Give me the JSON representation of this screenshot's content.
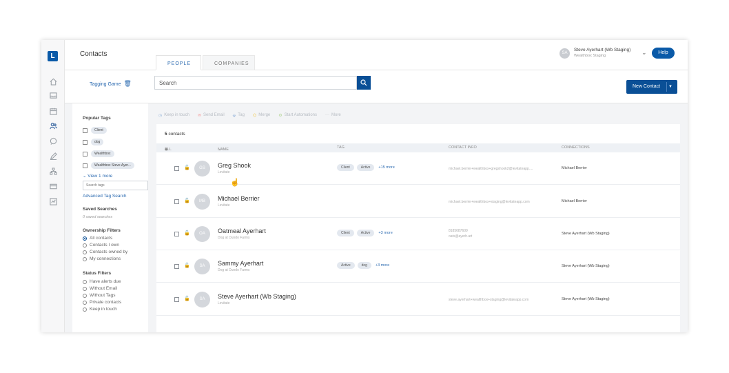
{
  "app": {
    "logo_letter": "L",
    "page_title": "Contacts"
  },
  "tabs": [
    {
      "label": "PEOPLE"
    },
    {
      "label": "COMPANIES"
    }
  ],
  "user": {
    "initials": "SA",
    "name": "Steve Ayerhart (Wb Staging)",
    "org": "Wealthbox Staging",
    "help_label": "Help"
  },
  "toolbar": {
    "tagging_game": "Tagging Game",
    "search_placeholder": "Search",
    "new_contact": "New Contact"
  },
  "filters": {
    "popular_tags_title": "Popular Tags",
    "popular_tags": [
      "Client",
      "dog",
      "Wealthbox",
      "Wealthbox Steve Ayer..."
    ],
    "view_more": "View 1 more",
    "search_tags_placeholder": "Search tags",
    "advanced_tag_search": "Advanced Tag Search",
    "saved_searches_title": "Saved Searches",
    "saved_searches_empty": "0 saved searches",
    "ownership_title": "Ownership Filters",
    "ownership_options": [
      "All contacts",
      "Contacts I own",
      "Contacts owned by",
      "My connections"
    ],
    "ownership_selected": "All contacts",
    "status_title": "Status Filters",
    "status_options": [
      "Have alerts due",
      "Without Email",
      "Without Tags",
      "Private contacts",
      "Keep in touch"
    ]
  },
  "actions": [
    "Keep in touch",
    "Send Email",
    "Tag",
    "Merge",
    "Start Automations",
    "More"
  ],
  "table": {
    "count_number": "5",
    "count_label": "contacts",
    "headers": {
      "all": "ALL",
      "name": "NAME",
      "tag": "TAG",
      "contact_info": "CONTACT INFO",
      "connections": "CONNECTIONS"
    },
    "rows": [
      {
        "initials": "GS",
        "name": "Greg Shook",
        "sub": "Levitate",
        "tags": [
          "Client",
          "Active"
        ],
        "more": "+15 more",
        "contact": [
          "michael.berrier+wealthbox+gregshook2@levitateapp...."
        ],
        "connection": "Michael Berrier"
      },
      {
        "initials": "MB",
        "name": "Michael Berrier",
        "sub": "Levitate",
        "tags": [],
        "more": "",
        "contact": [
          "michael.berrier+wealthbox+staging@levitateapp.com"
        ],
        "connection": "Michael Berrier"
      },
      {
        "initials": "OA",
        "name": "Oatmeal Ayerhart",
        "sub": "Dog at Dundo Farms",
        "tags": [
          "Client",
          "Active"
        ],
        "more": "+3 more",
        "contact": [
          "8185687609",
          "oats@ayerh.art"
        ],
        "connection": "Steve Ayerhart (Wb Staging)"
      },
      {
        "initials": "SA",
        "name": "Sammy Ayerhart",
        "sub": "Dog at Dundo Farms",
        "tags": [
          "Active",
          "dog"
        ],
        "more": "+3 more",
        "contact": [],
        "connection": "Steve Ayerhart (Wb Staging)"
      },
      {
        "initials": "SA",
        "name": "Steve Ayerhart (Wb Staging)",
        "sub": "Levitate",
        "tags": [],
        "more": "",
        "contact": [
          "steve.ayerhart+wealthbox+staging@levitateapp.com"
        ],
        "connection": "Steve Ayerhart (Wb Staging)"
      }
    ]
  },
  "colors": {
    "brand": "#0a5aa8",
    "button": "#0a4f96",
    "link": "#2b6ab0"
  }
}
